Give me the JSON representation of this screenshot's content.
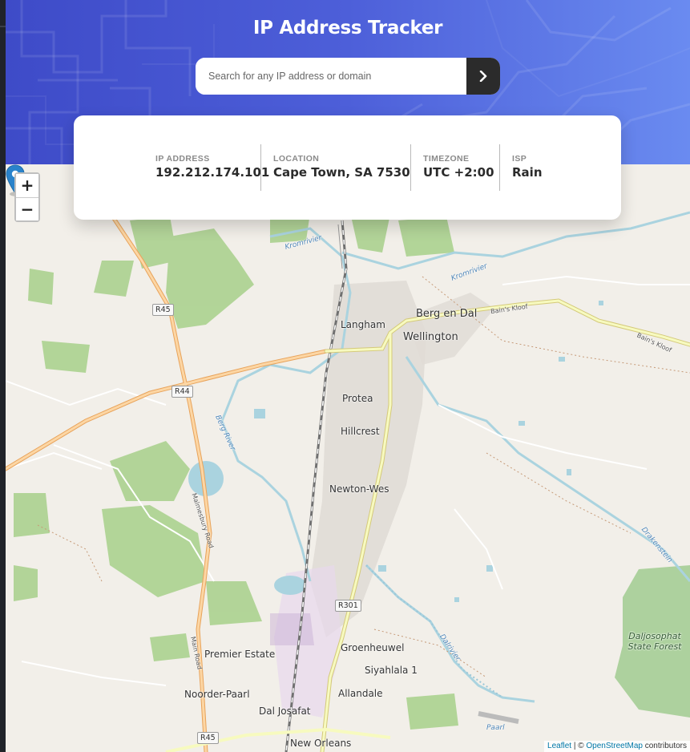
{
  "app": {
    "title": "IP Address Tracker"
  },
  "search": {
    "placeholder": "Search for any IP address or domain",
    "value": "",
    "button_icon": "chevron-right-icon"
  },
  "info": [
    {
      "label": "IP ADDRESS",
      "value": "192.212.174.101"
    },
    {
      "label": "LOCATION",
      "value": "Cape Town, SA 7530"
    },
    {
      "label": "TIMEZONE",
      "value": "UTC +2:00"
    },
    {
      "label": "ISP",
      "value": "Rain"
    }
  ],
  "map": {
    "zoom_in_label": "+",
    "zoom_out_label": "−",
    "marker_icon": "location-pin-icon",
    "places": [
      "Berg en Dal",
      "Wellington",
      "Langham",
      "Protea",
      "Hillcrest",
      "Newton-Wes",
      "Groenheuwel",
      "Siyahlala 1",
      "Allandale",
      "Premier Estate",
      "Noorder-Paarl",
      "Dal Josafat",
      "New Orleans"
    ],
    "roads": [
      "R45",
      "R44",
      "R301",
      "R45",
      "Bain's Kloof",
      "Bain's Kloof",
      "Malmesbury Road",
      "Main Road"
    ],
    "water": [
      "Kromrivier",
      "Kromrivier",
      "Berg River",
      "Dalrivier",
      "Drakenstein",
      "Paarl"
    ],
    "forest": "Daljosophat State Forest",
    "attribution": {
      "leaflet": "Leaflet",
      "sep": " | © ",
      "osm": "OpenStreetMap",
      "suffix": " contributors"
    }
  },
  "colors": {
    "header_start": "#3e4bc8",
    "header_end": "#6a8bf0",
    "button": "#2b2b2b",
    "marker": "#2a83cb"
  }
}
